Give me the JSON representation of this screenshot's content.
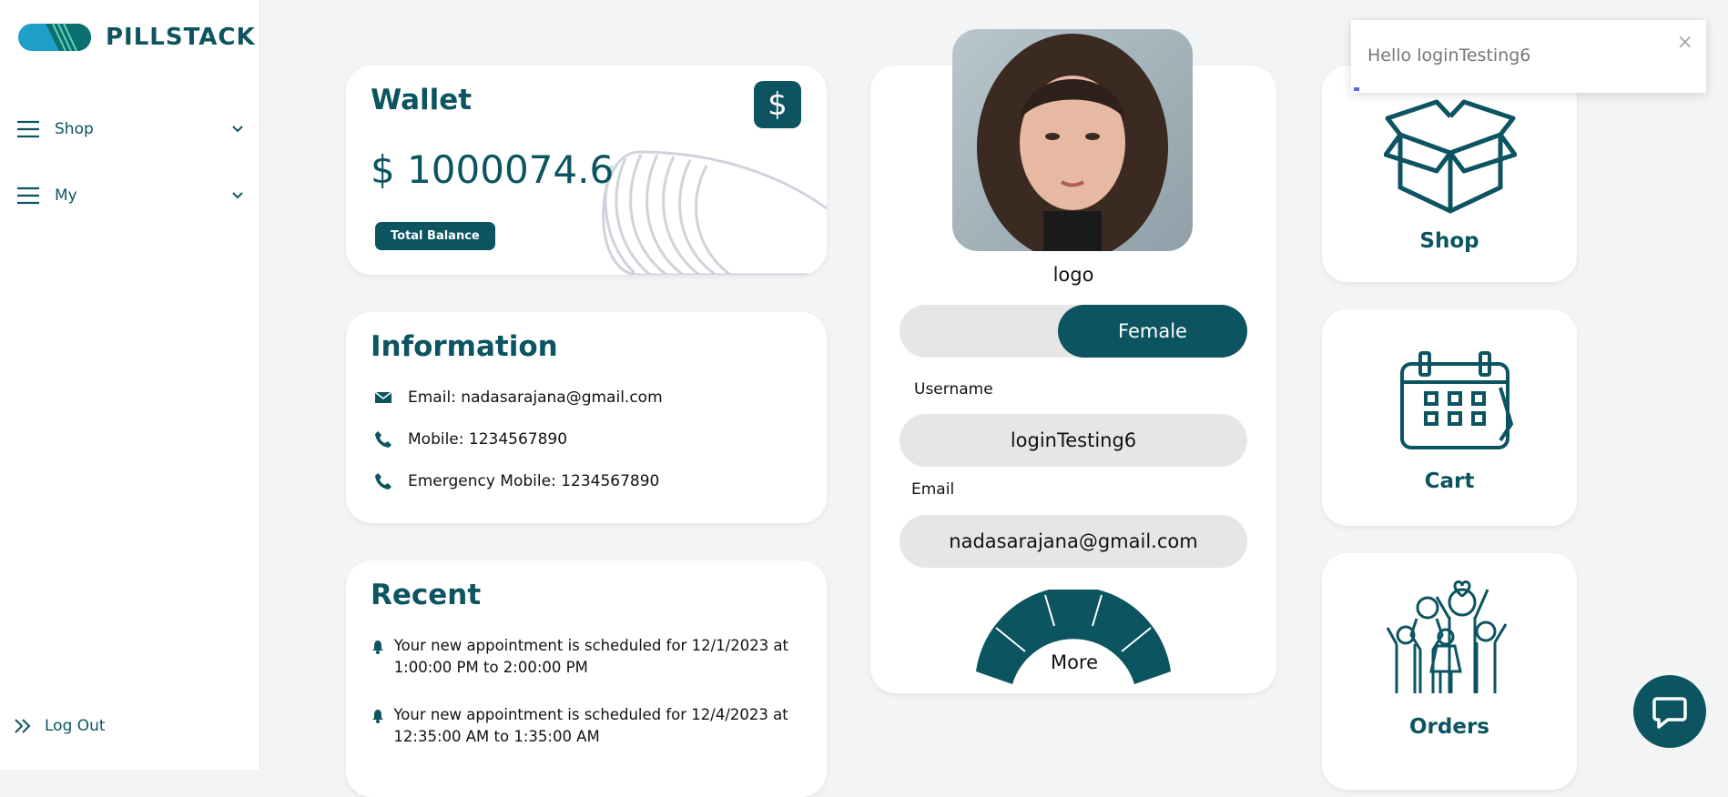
{
  "brand": {
    "name": "PILLSTACK"
  },
  "sidebar": {
    "items": [
      {
        "label": "Shop",
        "icon": "menu-icon"
      },
      {
        "label": "My",
        "icon": "menu-icon"
      }
    ],
    "logout_label": "Log Out"
  },
  "wallet": {
    "title": "Wallet",
    "currency_symbol": "$",
    "amount": "$ 1000074.6",
    "badge_label": "Total Balance"
  },
  "information": {
    "title": "Information",
    "rows": [
      {
        "icon": "envelope-icon",
        "text": "Email: nadasarajana@gmail.com"
      },
      {
        "icon": "phone-icon",
        "text": "Mobile: 1234567890"
      },
      {
        "icon": "phone-icon",
        "text": "Emergency Mobile: 1234567890"
      }
    ]
  },
  "recent": {
    "title": "Recent",
    "items": [
      {
        "icon": "bell-icon",
        "text": "Your new appointment is scheduled for 12/1/2023 at 1:00:00 PM to 2:00:00 PM"
      },
      {
        "icon": "bell-icon",
        "text": "Your new appointment is scheduled for 12/4/2023 at 12:35:00 AM to 1:35:00 AM"
      }
    ]
  },
  "profile": {
    "photo_alt": "logo",
    "gender_selected": "Female",
    "username_label": "Username",
    "username": "loginTesting6",
    "email_label": "Email",
    "email": "nadasarajana@gmail.com",
    "more_label": "More"
  },
  "tiles": [
    {
      "label": "Shop",
      "icon": "box-icon"
    },
    {
      "label": "Cart",
      "icon": "calendar-icon"
    },
    {
      "label": "Orders",
      "icon": "family-icon"
    }
  ],
  "toast": {
    "message": "Hello loginTesting6",
    "close": "×"
  },
  "colors": {
    "primary": "#0b5460",
    "background": "#f3f4f6",
    "field": "#e6e6e6"
  }
}
